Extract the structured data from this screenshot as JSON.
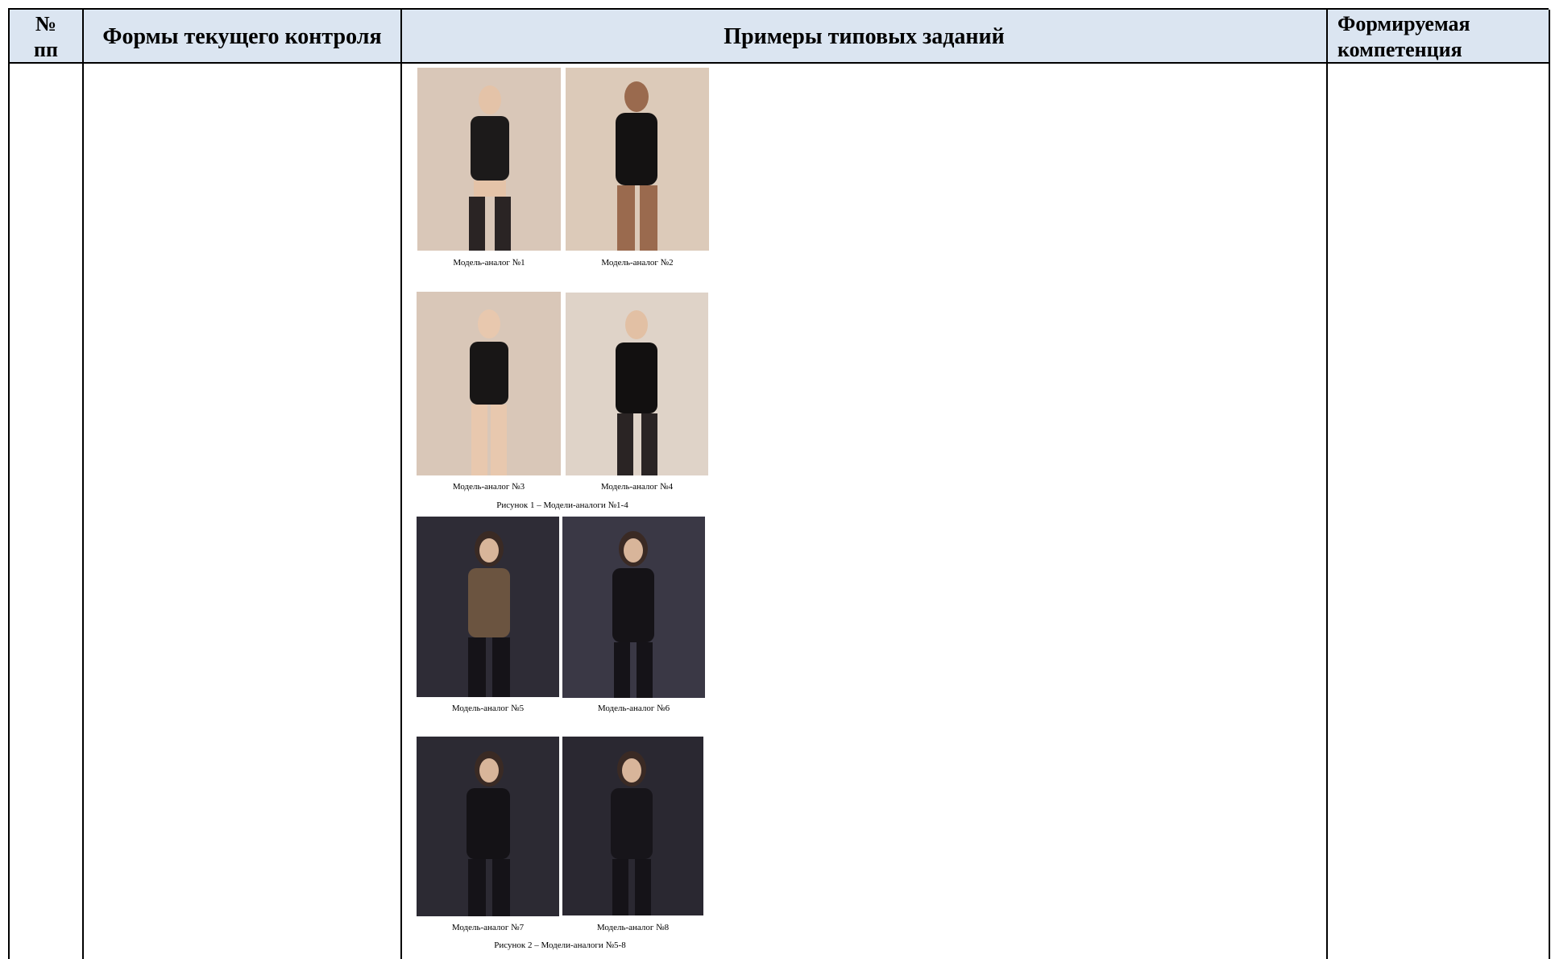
{
  "table": {
    "headers": {
      "num": "№\nпп",
      "forms": "Формы текущего контроля",
      "examples": "Примеры типовых заданий",
      "competence": "Формируемая\nкомпетенция"
    }
  },
  "figure1": {
    "captions": [
      "Модель-аналог №1",
      "Модель-аналог №2",
      "Модель-аналог №3",
      "Модель-аналог №4"
    ],
    "title": "Рисунок 1 – Модели-аналоги №1-4"
  },
  "figure2": {
    "captions": [
      "Модель-аналог №5",
      "Модель-аналог №6",
      "Модель-аналог №7",
      "Модель-аналог №8"
    ],
    "title": "Рисунок 2 – Модели-аналоги №5-8"
  },
  "colors": {
    "header_bg": "#dbe5f1",
    "light_photo_bg": "#d9c7b8",
    "dark_photo_bg": "#2e2c36"
  }
}
